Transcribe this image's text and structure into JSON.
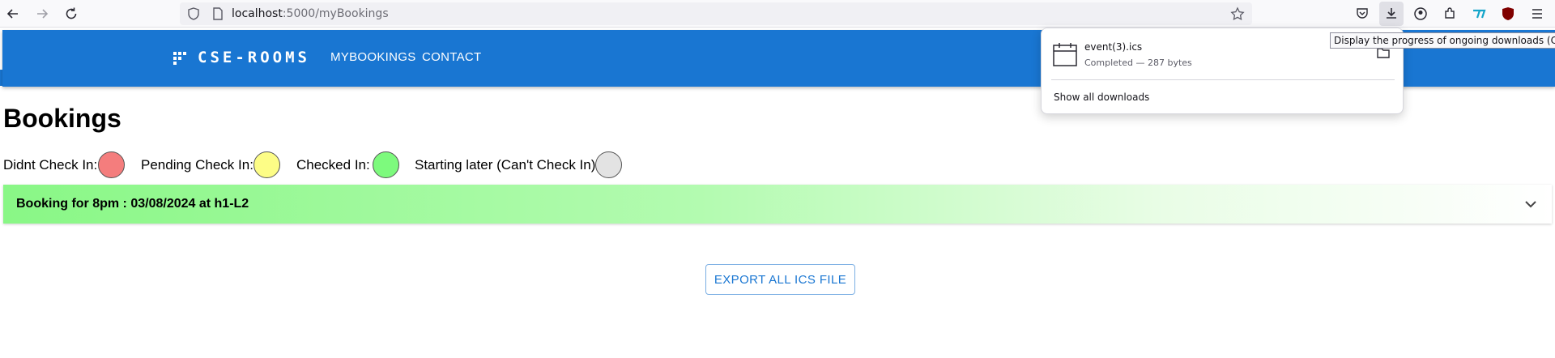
{
  "browser": {
    "url_host": "localhost",
    "url_path": ":5000/myBookings",
    "tooltip": "Display the progress of ongoing downloads (Ctrl+J)"
  },
  "downloads": {
    "file_name": "event(3).ics",
    "status": "Completed — 287 bytes",
    "show_all": "Show all downloads"
  },
  "app": {
    "brand": "CSE-ROOMS",
    "nav": [
      "MYBOOKINGS",
      "CONTACT"
    ],
    "title": "Bookings",
    "legend": [
      {
        "label": "Didnt Check In:",
        "color": "#f47d7d"
      },
      {
        "label": "Pending Check In:",
        "color": "#fdfd86"
      },
      {
        "label": "Checked In:",
        "color": "#7dfa7d"
      },
      {
        "label": "Starting later (Can't Check In):",
        "color": "#e3e3e3"
      }
    ],
    "booking": "Booking for 8pm : 03/08/2024 at h1-L2",
    "export_label": "EXPORT ALL ICS FILE",
    "accent": "#1976d2"
  }
}
